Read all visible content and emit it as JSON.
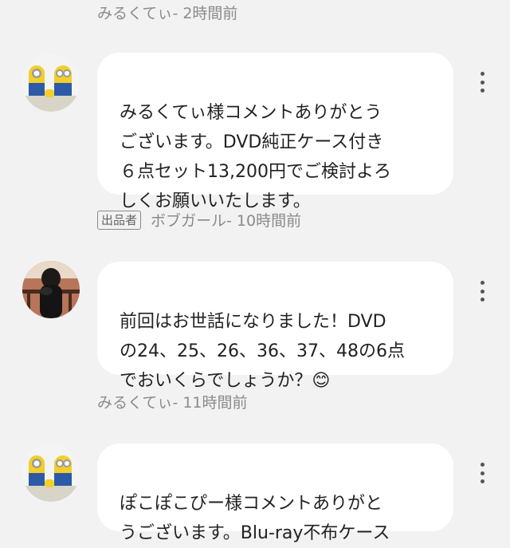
{
  "comments": [
    {
      "meta_name": "みるくてぃ",
      "meta_time": " - 2時間前",
      "avatar_icon": "minion-figures-avatar",
      "text": "みるくてぃ様コメントありがとう\nございます。DVD純正ケース付き\n６点セット13,200円でご検討よろ\nしくお願いいたします。",
      "menu_icon": "more-vert-icon"
    },
    {
      "seller_badge": "出品者",
      "meta_name": "ボブガール",
      "meta_time": " - 10時間前",
      "avatar_icon": "person-photo-avatar",
      "text": "前回はお世話になりました！DVD\nの24、25、26、36、37、48の6点\nでおいくらでしょうか？😊",
      "menu_icon": "more-vert-icon"
    },
    {
      "meta_name": "みるくてぃ",
      "meta_time": " - 11時間前",
      "avatar_icon": "minion-figures-avatar",
      "text": "ぽこぽこぴー様コメントありがと\nうございます。Blu-ray不布ケース",
      "menu_icon": "more-vert-icon"
    }
  ]
}
